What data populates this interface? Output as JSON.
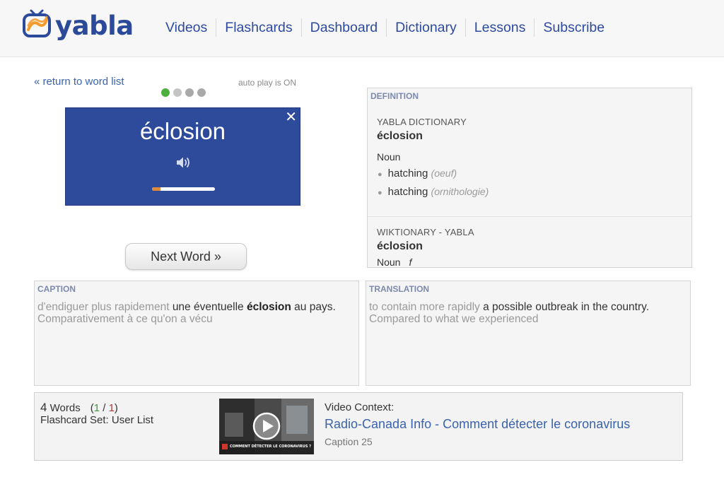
{
  "brand": {
    "name": "yabla"
  },
  "nav": [
    {
      "label": "Videos"
    },
    {
      "label": "Flashcards"
    },
    {
      "label": "Dashboard"
    },
    {
      "label": "Dictionary"
    },
    {
      "label": "Lessons"
    },
    {
      "label": "Subscribe"
    }
  ],
  "flashcard": {
    "return_link": "« return to word list",
    "autoplay_status": "auto play is ON",
    "word": "éclosion",
    "close_glyph": "✕",
    "progress_fraction": 0.13,
    "next_button": "Next Word »"
  },
  "definition": {
    "label": "DEFINITION",
    "sources": [
      {
        "source": "YABLA DICTIONARY",
        "word": "éclosion",
        "pos": "Noun",
        "senses": [
          {
            "text": "hatching",
            "note": "(oeuf)"
          },
          {
            "text": "hatching",
            "note": "(ornithologie)"
          }
        ]
      },
      {
        "source": "WIKTIONARY - YABLA",
        "word": "éclosion",
        "pos": "Noun",
        "gender": "f"
      }
    ]
  },
  "caption": {
    "label": "CAPTION",
    "before": "d'endiguer plus rapidement ",
    "highlight_pre": "une éventuelle ",
    "keyword": "éclosion",
    "highlight_post": " au pays.",
    "after": " Comparativement à ce qu'on a vécu"
  },
  "translation": {
    "label": "TRANSLATION",
    "before": "to contain more rapidly ",
    "highlight": "a possible outbreak in the country.",
    "after": " Compared to what we experienced"
  },
  "bottom": {
    "word_count": "4",
    "words_label": " Words",
    "progress_open": "(",
    "progress_current": "1",
    "progress_sep": " / ",
    "progress_total": "1",
    "progress_close": ")",
    "set_label": "Flashcard Set: ",
    "set_name": "User List",
    "thumb_caption": "COMMENT DÉTECTER LE CORONAVIRUS ?",
    "context_label": "Video Context:",
    "context_title": "Radio-Canada Info - Comment détecter le coronavirus",
    "context_caption": "Caption 25"
  },
  "colors": {
    "brand_blue": "#2c4a9a",
    "card_blue": "#2e4a9b",
    "link_blue": "#3a63ad",
    "logo_orange": "#f39a2b",
    "dot_active": "#4caf3e"
  },
  "icons": [
    "tv-logo-icon",
    "speaker-icon",
    "close-icon",
    "play-icon"
  ]
}
